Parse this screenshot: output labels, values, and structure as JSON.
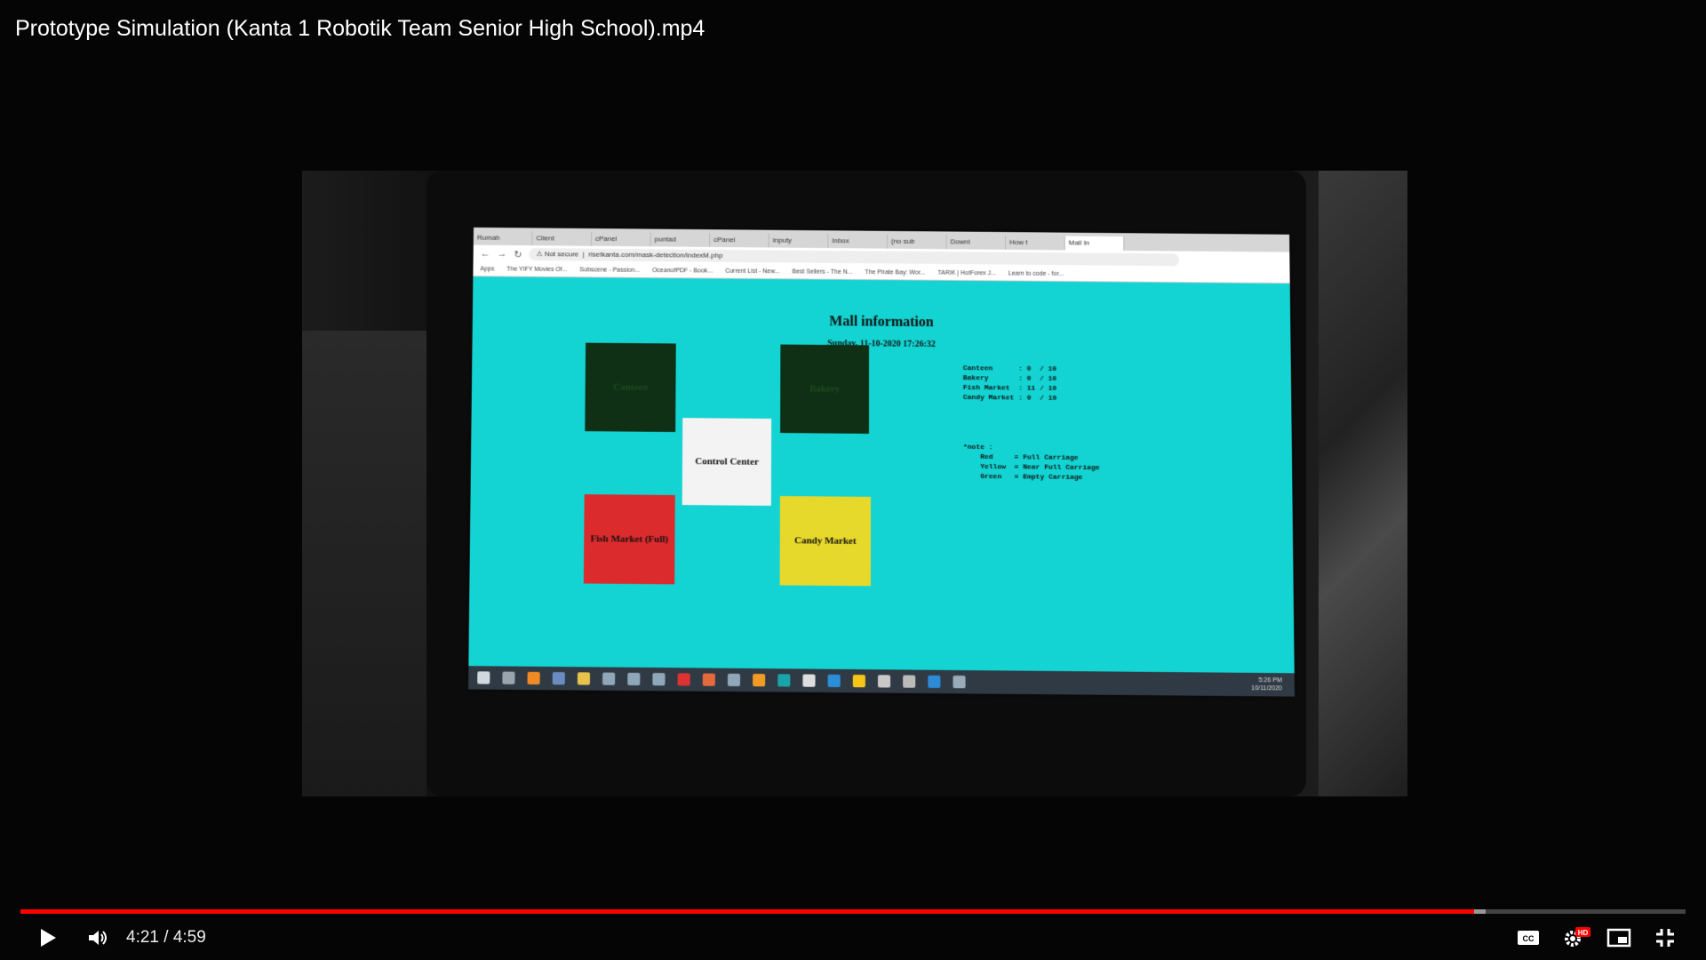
{
  "video": {
    "title": "Prototype Simulation (Kanta 1 Robotik Team Senior High School).mp4"
  },
  "browser": {
    "tabs": [
      "Rumah",
      "Client",
      "cPanel",
      "puntad",
      "cPanel",
      "inputy",
      "Inbox",
      "(no sub",
      "Downl",
      "How t",
      "Mall In"
    ],
    "security_label": "Not secure",
    "url": "risetkanta.com/mask-detection/indexM.php",
    "bookmarks": [
      "Apps",
      "The YIFY Movies Of...",
      "Subscene - Passion...",
      "OceanofPDF - Book...",
      "Current List - New...",
      "Best Sellers - The N...",
      "The Pirate Bay: Wor...",
      "TARIK | HotForex J...",
      "Learn to code - for..."
    ]
  },
  "mall": {
    "title": "Mall information",
    "datetime": "Sunday, 11-10-2020 17:26:32",
    "rooms": {
      "canteen": "Canteen",
      "bakery": "Bakery",
      "control": "Control Center",
      "fish": "Fish Market (Full)",
      "candy": "Candy Market"
    },
    "counts_text": "Canteen      : 0  / 10\nBakery       : 0  / 10\nFish Market  : 11 / 10\nCandy Market : 0  / 10",
    "note_text": "*note :\n    Red     = Full Carriage\n    Yellow  = Near Full Carriage\n    Green   = Empty Carriage"
  },
  "taskbar": {
    "time": "5:26 PM",
    "date": "10/11/2020"
  },
  "player": {
    "current_time": "4:21",
    "separator": " / ",
    "duration": "4:59",
    "progress_fraction": 0.873,
    "buffered_fraction": 0.88,
    "play_icon": "play-icon",
    "volume_icon": "volume-icon",
    "cc_icon": "closed-captions-icon",
    "settings_icon": "settings-icon",
    "hd_badge": "HD",
    "miniplayer_icon": "miniplayer-icon",
    "fullscreen_icon": "exit-fullscreen-icon",
    "accent_color": "#ff0000"
  }
}
